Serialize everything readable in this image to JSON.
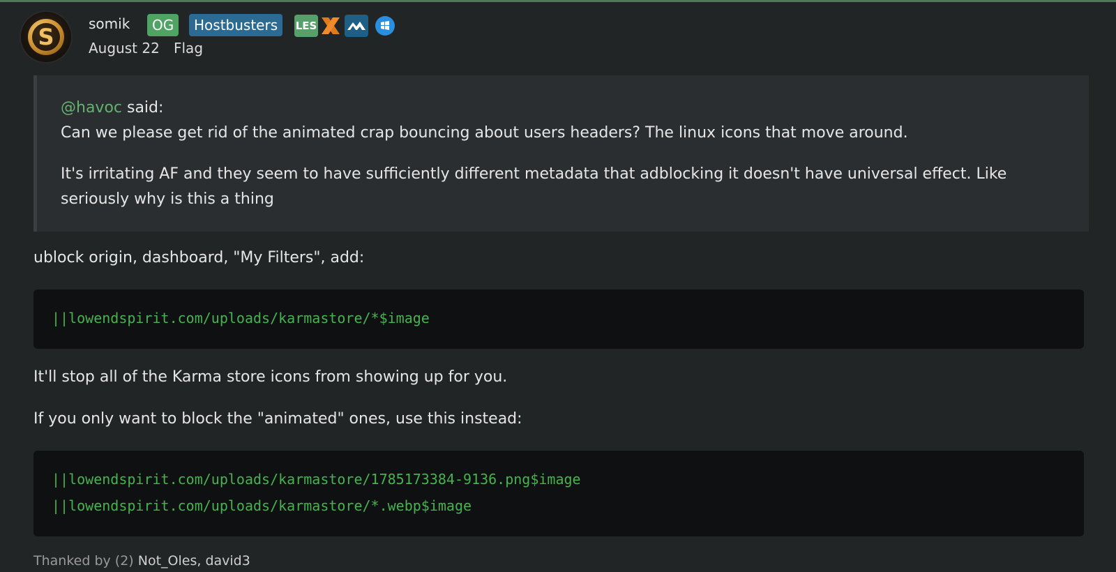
{
  "author": {
    "username": "somik",
    "avatar_letter": "S",
    "roles": [
      "OG",
      "Hostbusters"
    ],
    "karma_icons": [
      "les-icon",
      "x-icon",
      "mountain-icon",
      "windows-icon"
    ],
    "karma_les_text": "LES"
  },
  "meta": {
    "date": "August 22",
    "flag_label": "Flag"
  },
  "quote": {
    "mention": "@havoc",
    "said": " said:",
    "paragraphs": [
      "Can we please get rid of the animated crap bouncing about users headers? The linux icons that move around.",
      "It's irritating AF and they seem to have sufficiently different metadata that adblocking it doesn't have universal effect. Like seriously why is this a thing"
    ]
  },
  "body": {
    "intro": "ublock origin, dashboard, \"My Filters\", add:",
    "code1": [
      "||lowendspirit.com/uploads/karmastore/*$image"
    ],
    "explain": "It'll stop all of the Karma store icons from showing up for you.",
    "alt_intro": "If you only want to block the \"animated\" ones, use this instead:",
    "code2": [
      "||lowendspirit.com/uploads/karmastore/1785173384-9136.png$image",
      "||lowendspirit.com/uploads/karmastore/*.webp$image"
    ]
  },
  "thanks": {
    "label": "Thanked by (2)",
    "users": "Not_Oles, david3"
  },
  "colors": {
    "background": "#222526",
    "mention": "#62b36e",
    "code_text": "#46b34f",
    "badge_og": "#4fa463",
    "badge_hostbusters": "#2b6a93"
  }
}
